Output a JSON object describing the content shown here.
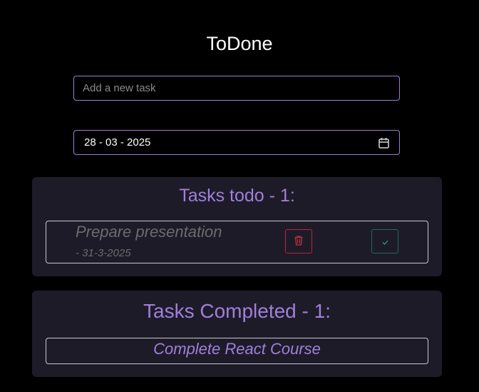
{
  "app": {
    "title": "ToDone"
  },
  "new_task": {
    "placeholder": "Add a new task",
    "value": ""
  },
  "date_picker": {
    "value": "28 - 03 - 2025",
    "icon": "calendar-icon"
  },
  "todo": {
    "heading": "Tasks todo - 1:",
    "tasks": [
      {
        "text": "Prepare presentation",
        "date": "- 31-3-2025",
        "delete_icon": "trash-icon",
        "complete_icon": "check-icon"
      }
    ]
  },
  "completed": {
    "heading": "Tasks Completed - 1:",
    "tasks": [
      {
        "text": "Complete React Course"
      }
    ]
  },
  "colors": {
    "background": "#000000",
    "accent": "#a07fd9",
    "panel": "#1e1b29",
    "delete": "#b8273a",
    "complete": "#1f6b4e"
  }
}
